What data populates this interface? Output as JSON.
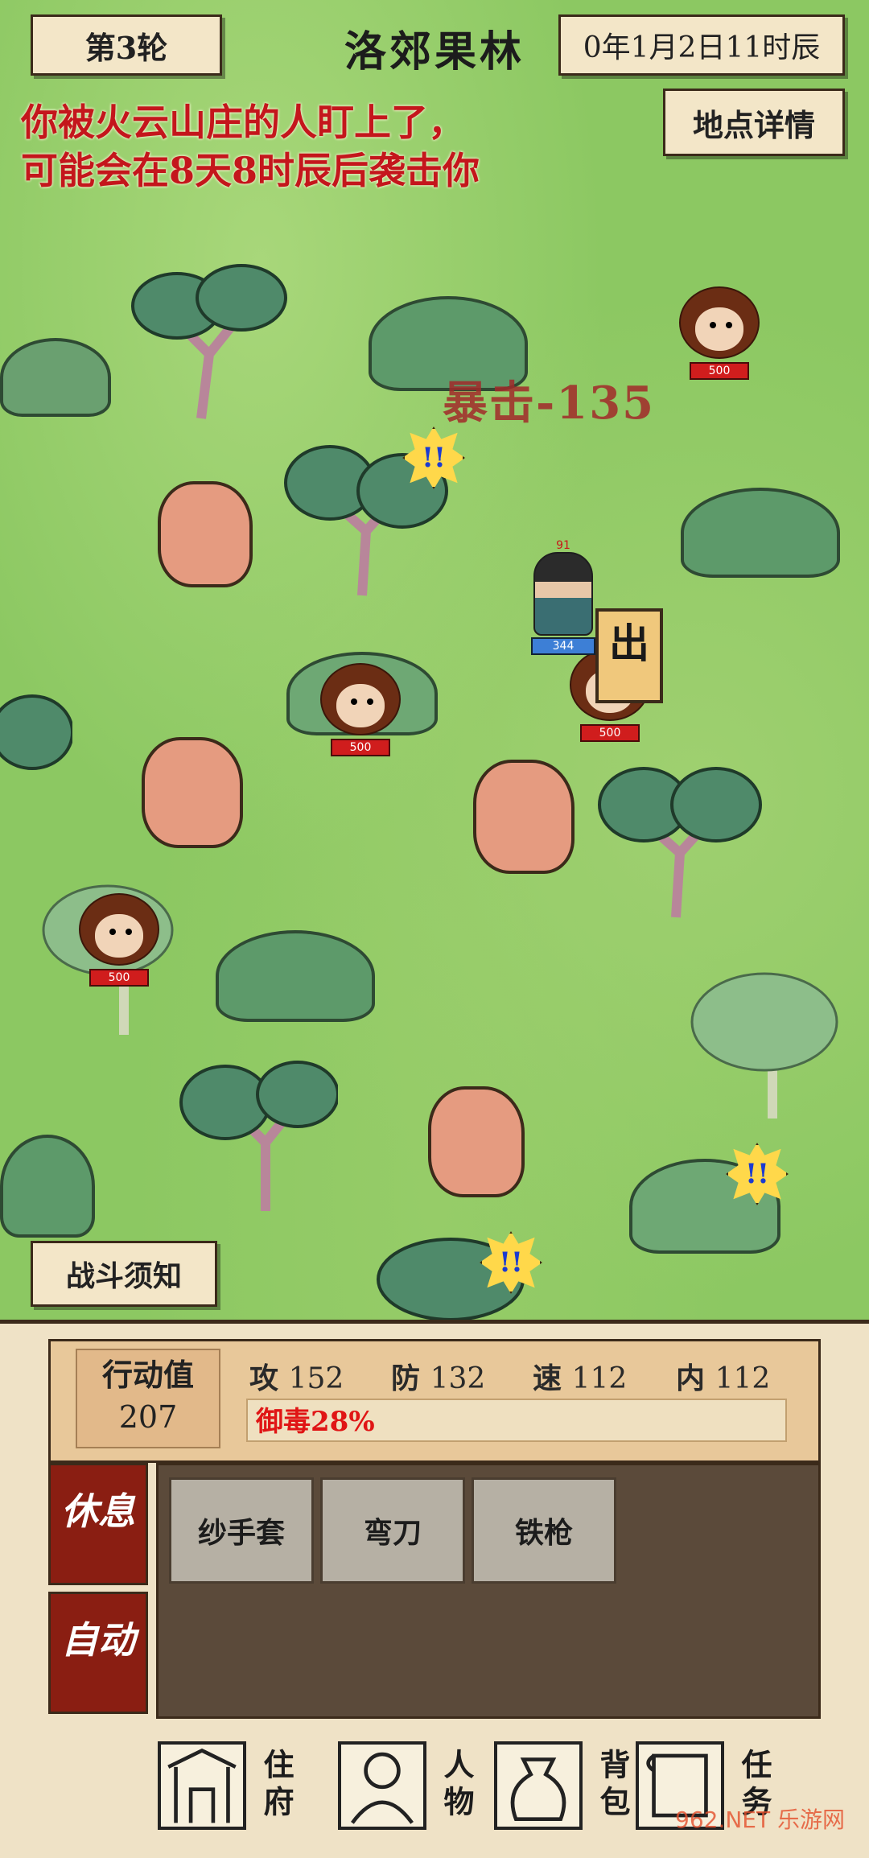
{
  "header": {
    "round": "第3轮",
    "location": "洛郊果林",
    "date": "0年1月2日11时辰",
    "location_details_button": "地点详情"
  },
  "warning": {
    "line1": "你被火云山庄的人盯上了，",
    "line2": "可能会在8天8时辰后袭击你"
  },
  "map": {
    "floating_damage": "暴击-135",
    "hero": {
      "level": "91",
      "hp": "344"
    },
    "exit_sign": "出",
    "monkeys": [
      {
        "hp": "500"
      },
      {
        "hp": "500"
      },
      {
        "hp": "500"
      },
      {
        "hp": "500"
      }
    ],
    "alert_glyph": "!!"
  },
  "battle_notice_button": "战斗须知",
  "stats": {
    "action_label": "行动值",
    "action_value": "207",
    "attack_label": "攻",
    "attack": "152",
    "defense_label": "防",
    "defense": "132",
    "speed_label": "速",
    "speed": "112",
    "internal_label": "内",
    "internal": "112",
    "poison_resist": "御毒28%"
  },
  "side_buttons": {
    "rest": "休息",
    "auto": "自动"
  },
  "items": [
    "纱手套",
    "弯刀",
    "铁枪"
  ],
  "nav": {
    "residence": "住府",
    "character": "人物",
    "bag": "背包",
    "quest": "任务"
  },
  "watermark": "962.NET 乐游网"
}
